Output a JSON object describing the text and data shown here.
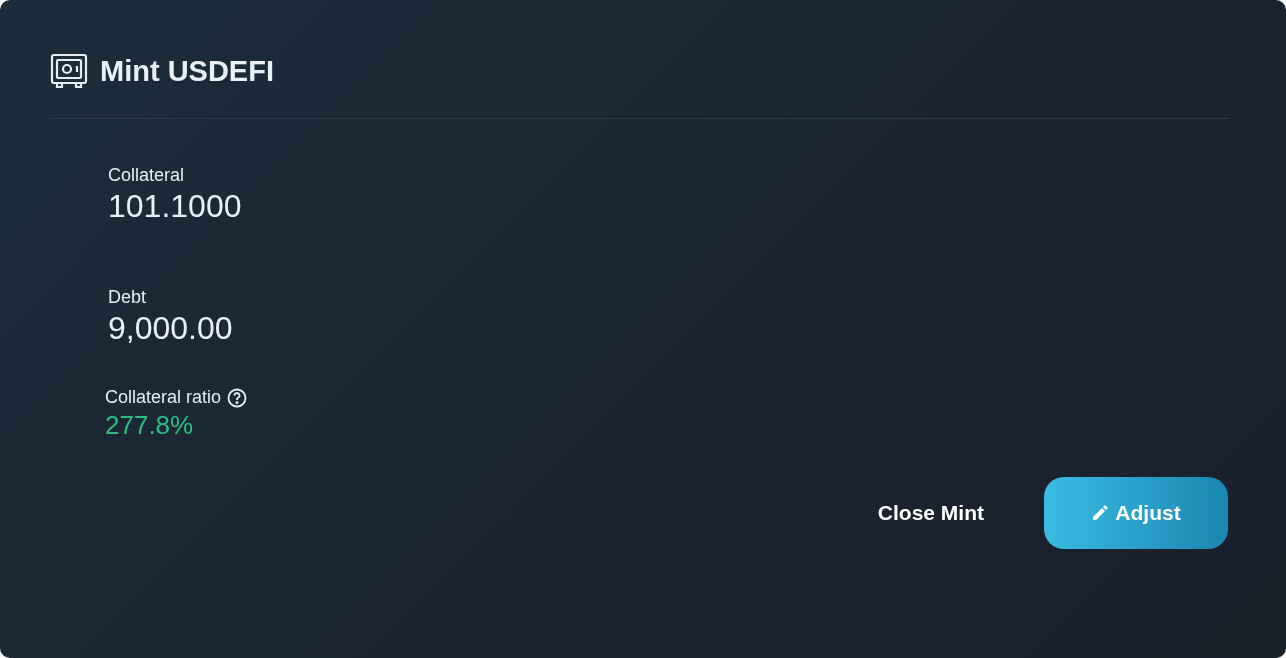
{
  "card": {
    "title": "Mint USDEFI"
  },
  "stats": [
    {
      "label": "Collateral",
      "value": "101.1000",
      "kind": "plain"
    },
    {
      "label": "Debt",
      "value": "9,000.00",
      "kind": "plain"
    },
    {
      "label": "Collateral ratio",
      "value": "277.8%",
      "kind": "ratio"
    }
  ],
  "buttons": [
    {
      "label": "Close Mint",
      "kind": "text"
    },
    {
      "label": "Adjust",
      "kind": "primary"
    }
  ]
}
